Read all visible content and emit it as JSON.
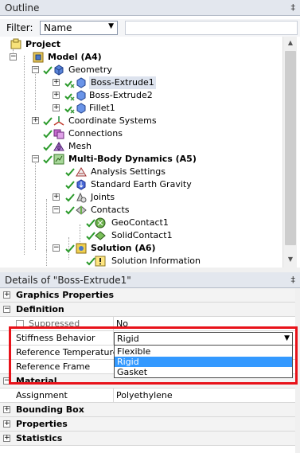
{
  "outline": {
    "title": "Outline",
    "pin": "‡",
    "filter_label": "Filter:",
    "filter_value": "Name"
  },
  "tree": [
    {
      "label": "Project",
      "bold": true,
      "icon": "project-icon"
    },
    {
      "label": "Model (A4)",
      "bold": true,
      "icon": "model-icon"
    },
    {
      "label": "Geometry",
      "bold": false,
      "icon": "geometry-icon"
    },
    {
      "label": "Boss-Extrude1",
      "bold": false,
      "icon": "body-icon",
      "selected": true
    },
    {
      "label": "Boss-Extrude2",
      "bold": false,
      "icon": "body-icon"
    },
    {
      "label": "Fillet1",
      "bold": false,
      "icon": "body-icon"
    },
    {
      "label": "Coordinate Systems",
      "bold": false,
      "icon": "coordinate-systems-icon"
    },
    {
      "label": "Connections",
      "bold": false,
      "icon": "connections-icon"
    },
    {
      "label": "Mesh",
      "bold": false,
      "icon": "mesh-icon"
    },
    {
      "label": "Multi-Body Dynamics (A5)",
      "bold": true,
      "icon": "analysis-icon"
    },
    {
      "label": "Analysis Settings",
      "bold": false,
      "icon": "analysis-settings-icon"
    },
    {
      "label": "Standard Earth Gravity",
      "bold": false,
      "icon": "gravity-icon"
    },
    {
      "label": "Joints",
      "bold": false,
      "icon": "joints-icon"
    },
    {
      "label": "Contacts",
      "bold": false,
      "icon": "contacts-icon"
    },
    {
      "label": "GeoContact1",
      "bold": false,
      "icon": "contact-icon"
    },
    {
      "label": "SolidContact1",
      "bold": false,
      "icon": "contact-icon"
    },
    {
      "label": "Solution (A6)",
      "bold": true,
      "icon": "solution-icon"
    },
    {
      "label": "Solution Information",
      "bold": false,
      "icon": "solution-information-icon"
    }
  ],
  "details": {
    "title": "Details of \"Boss-Extrude1\"",
    "pin": "‡",
    "rows": {
      "graphics_properties": "Graphics Properties",
      "definition": "Definition",
      "suppressed_name": "Suppressed",
      "suppressed_value": "No",
      "stiffness_name": "Stiffness Behavior",
      "stiffness_value": "Rigid",
      "reference_temperature_name": "Reference Temperature",
      "reference_frame_name": "Reference Frame",
      "material": "Material",
      "assignment_name": "Assignment",
      "assignment_value": "Polyethylene",
      "bounding_box": "Bounding Box",
      "properties": "Properties",
      "statistics": "Statistics"
    },
    "dropdown_options": [
      "Flexible",
      "Rigid",
      "Gasket"
    ],
    "dropdown_selected": "Rigid"
  },
  "colors": {
    "highlight_frame": "#e8121a",
    "selection": "#3399ff",
    "panel_header": "#e3e7ee"
  }
}
